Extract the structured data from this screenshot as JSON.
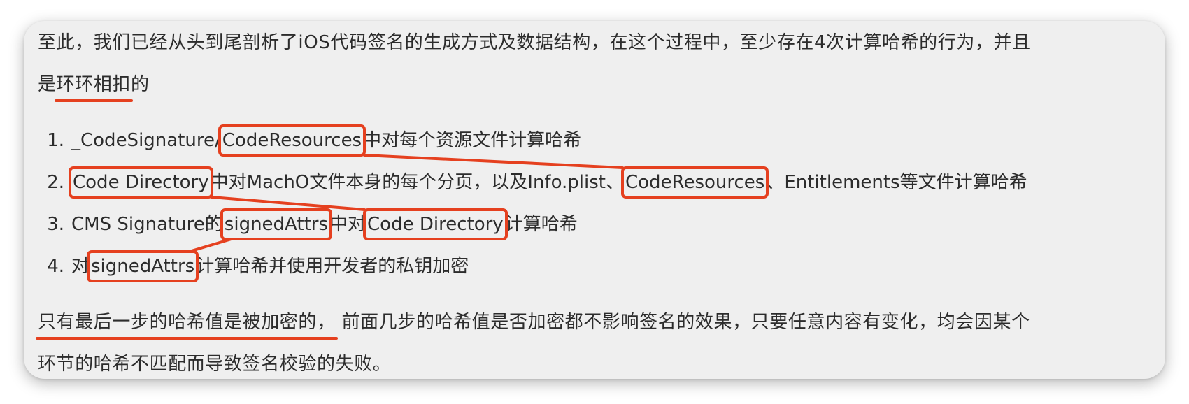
{
  "paragraph1": {
    "line1": "至此，我们已经从头到尾剖析了iOS代码签名的生成方式及数据结构，在这个过程中，至少存在4次计算哈希的行为，并且",
    "line2_prefix": "是",
    "line2_highlight": "环环相扣",
    "line2_suffix": "的"
  },
  "list": [
    {
      "number": "1.",
      "prefix": "_CodeSignature/",
      "boxed1": "CodeResources",
      "suffix": "中对每个资源文件计算哈希"
    },
    {
      "number": "2.",
      "boxed1": "Code Directory",
      "middle": "中对MachO文件本身的每个分页，以及Info.plist、",
      "boxed2": "CodeResources",
      "suffix": "、Entitlements等文件计算哈希"
    },
    {
      "number": "3.",
      "prefix": "CMS Signature的",
      "boxed1": "signedAttrs",
      "middle": "中对",
      "boxed2": "Code Directory",
      "suffix": "计算哈希"
    },
    {
      "number": "4.",
      "prefix": "对",
      "boxed1": "signedAttrs",
      "suffix": "计算哈希并使用开发者的私钥加密"
    }
  ],
  "paragraph2": {
    "line1_highlight": "只有最后一步的哈希值是被加密的，",
    "line1_rest": " 前面几步的哈希值是否加密都不影响签名的效果，只要任意内容有变化，均会因某个",
    "line2": "环节的哈希不匹配而导致签名校验的失败。"
  },
  "annotation": {
    "color": "#e5401f",
    "connectors": [
      {
        "from": "list.0.boxed1",
        "to": "list.1.boxed2"
      },
      {
        "from": "list.1.boxed1",
        "to": "list.2.boxed2"
      },
      {
        "from": "list.2.boxed1",
        "to": "list.3.boxed1"
      }
    ]
  }
}
